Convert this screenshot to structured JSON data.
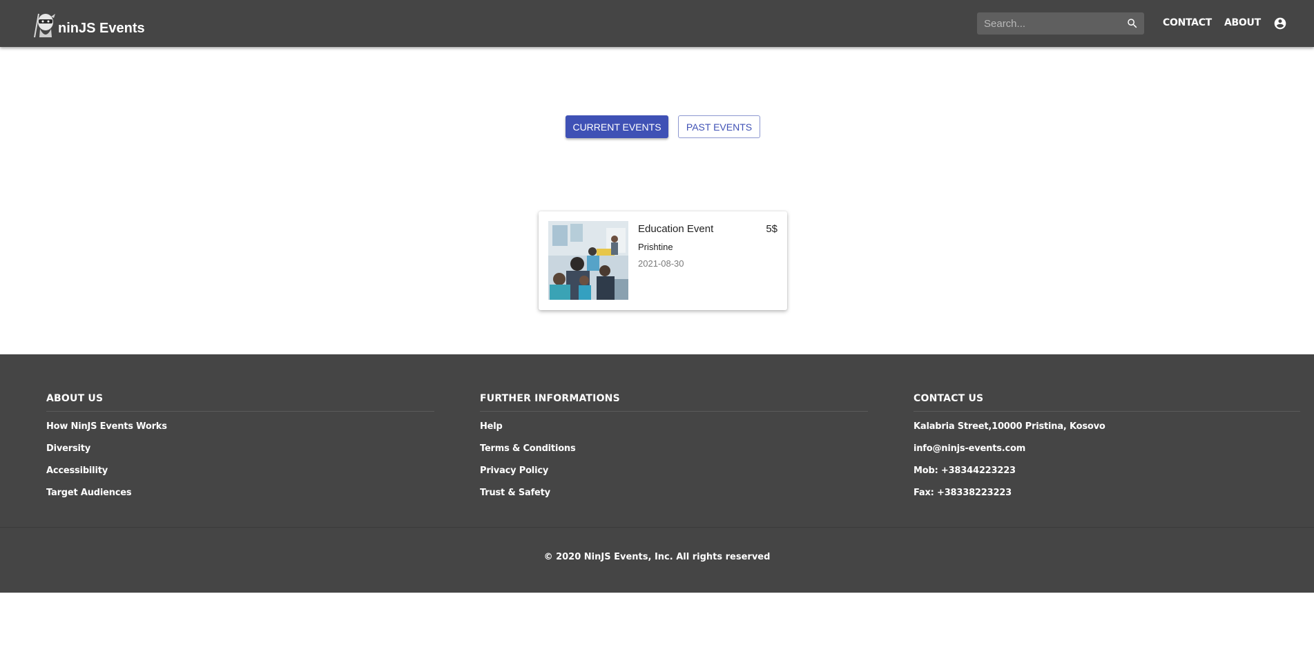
{
  "header": {
    "brand": "ninJS Events",
    "search_placeholder": "Search...",
    "search_value": "",
    "nav": {
      "contact": "CONTACT",
      "about": "ABOUT"
    },
    "icons": {
      "logo": "ninja-logo-icon",
      "search": "search-icon",
      "account": "account-circle-icon"
    }
  },
  "tabs": {
    "current": "CURRENT EVENTS",
    "past": "PAST EVENTS",
    "active": "current"
  },
  "events": [
    {
      "title": "Education Event",
      "price": "5$",
      "location": "Prishtine",
      "date": "2021-08-30",
      "image": "classroom-photo"
    }
  ],
  "footer": {
    "about": {
      "heading": "ABOUT US",
      "links": [
        "How NinJS Events Works",
        "Diversity",
        "Accessibility",
        "Target Audiences"
      ]
    },
    "further": {
      "heading": "FURTHER INFORMATIONS",
      "links": [
        "Help",
        "Terms & Conditions",
        "Privacy Policy",
        "Trust & Safety"
      ]
    },
    "contact": {
      "heading": "CONTACT US",
      "items": [
        "Kalabria Street,10000 Pristina, Kosovo",
        "info@ninjs-events.com",
        "Mob: +38344223223",
        "Fax: +38338223223"
      ]
    },
    "copyright": "© 2020 NinJS Events, Inc. All rights reserved"
  },
  "colors": {
    "header_bg": "#454545",
    "primary": "#3f51b5",
    "footer_bg": "#454545"
  }
}
